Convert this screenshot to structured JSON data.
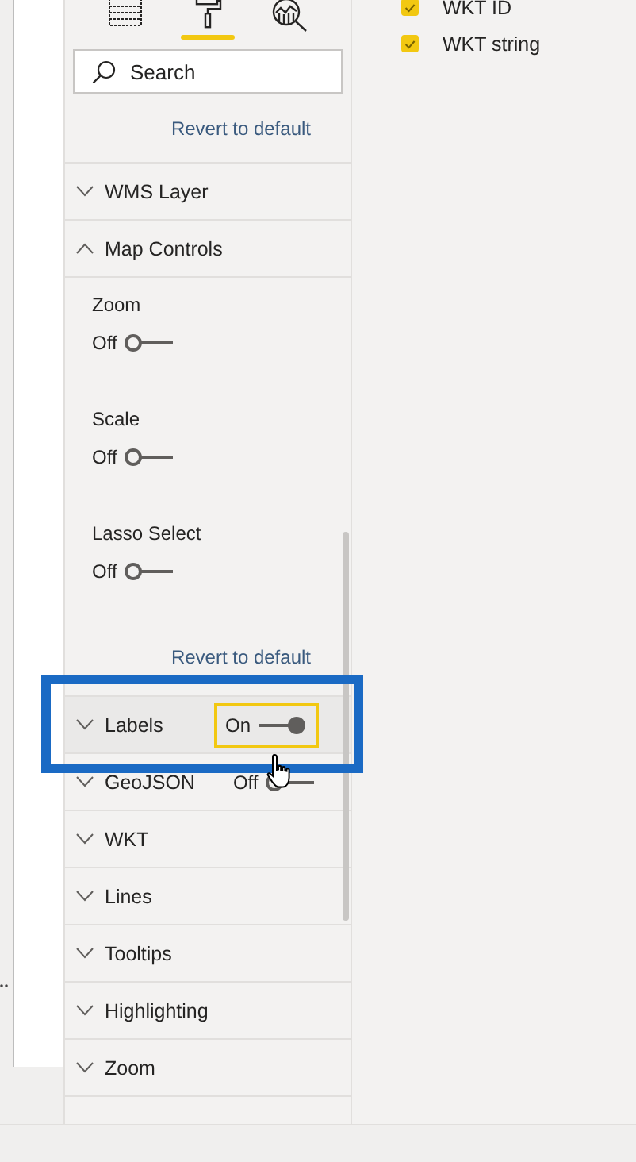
{
  "tabs": [
    {
      "kind": "fields",
      "selected": false
    },
    {
      "kind": "format",
      "selected": true
    },
    {
      "kind": "analytics",
      "selected": false
    }
  ],
  "search": {
    "placeholder": "Search"
  },
  "revert_top": "Revert to default",
  "sections": [
    {
      "title": "WMS Layer",
      "expanded": false
    },
    {
      "title": "Map Controls",
      "expanded": true,
      "settings": [
        {
          "label": "Zoom",
          "state": "Off",
          "on": false
        },
        {
          "label": "Scale",
          "state": "Off",
          "on": false
        },
        {
          "label": "Lasso Select",
          "state": "Off",
          "on": false
        }
      ],
      "revert": "Revert to default"
    },
    {
      "title": "Labels",
      "expanded": false,
      "highlighted": true,
      "toggle": {
        "state": "On",
        "on": true,
        "focused": true
      }
    },
    {
      "title": "GeoJSON",
      "expanded": false,
      "toggle": {
        "state": "Off",
        "on": false,
        "focused": false
      }
    },
    {
      "title": "WKT",
      "expanded": false
    },
    {
      "title": "Lines",
      "expanded": false
    },
    {
      "title": "Tooltips",
      "expanded": false
    },
    {
      "title": "Highlighting",
      "expanded": false
    },
    {
      "title": "Zoom",
      "expanded": false
    }
  ],
  "fields": [
    {
      "name": "WKT ID",
      "checked": true
    },
    {
      "name": "WKT string",
      "checked": true
    }
  ]
}
